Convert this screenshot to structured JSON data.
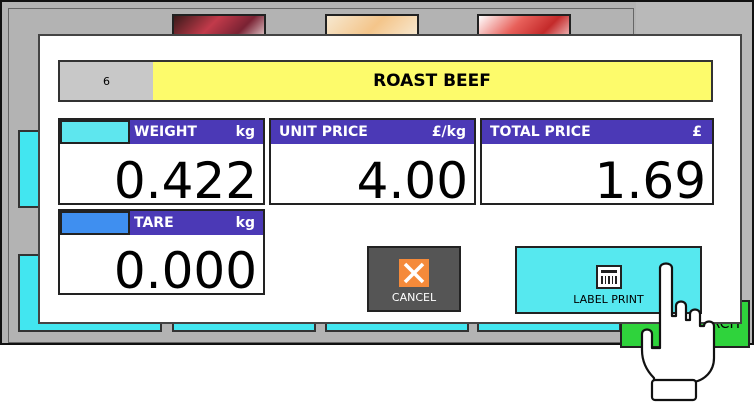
{
  "item": {
    "plu_number": "6",
    "name": "ROAST BEEF"
  },
  "weight": {
    "header": "WEIGHT",
    "unit": "kg",
    "value": "0.422",
    "swatch_color": "#5ee6ee"
  },
  "unit_price": {
    "header": "UNIT PRICE",
    "unit": "£/kg",
    "value": "4.00"
  },
  "total_price": {
    "header": "TOTAL PRICE",
    "unit": "£",
    "value": "1.69"
  },
  "tare": {
    "header": "TARE",
    "unit": "kg",
    "value": "0.000",
    "swatch_color": "#3f8ff0"
  },
  "buttons": {
    "cancel_label": "CANCEL",
    "label_print_label": "LABEL PRINT"
  },
  "background": {
    "search_label": "RCH"
  },
  "colors": {
    "field_header": "#4b39b6",
    "item_name_bg": "#fdfb6b",
    "label_print_bg": "#56e8ef",
    "cancel_bg": "#555555",
    "cancel_icon": "#f58a3a",
    "background_tile": "#42e6f0",
    "search_button": "#2fd33c"
  }
}
